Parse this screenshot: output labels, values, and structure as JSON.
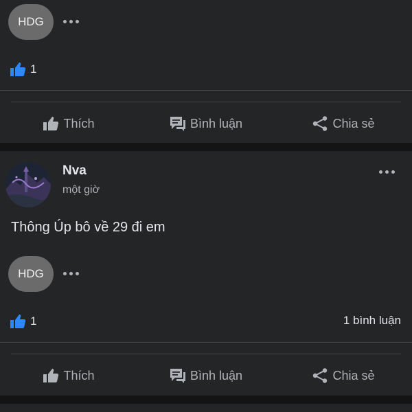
{
  "posts": [
    {
      "chip": "HDG",
      "likes": "1",
      "actions": {
        "like": "Thích",
        "comment": "Bình luận",
        "share": "Chia sẻ"
      }
    },
    {
      "author": "Nva",
      "time": "một giờ",
      "text": "Thông Úp bô về 29 đi em",
      "chip": "HDG",
      "likes": "1",
      "comments": "1 bình luận",
      "actions": {
        "like": "Thích",
        "comment": "Bình luận",
        "share": "Chia sẻ"
      }
    }
  ],
  "icons": {
    "reaction": "like-reaction-icon",
    "like": "thumbs-up-icon",
    "comment": "comment-bubble-icon",
    "share": "share-icon",
    "more": "more-dots-icon"
  },
  "colors": {
    "background": "#141414",
    "card": "#242526",
    "like_blue": "#2d88ff",
    "secondary_text": "#b0b3b8"
  }
}
